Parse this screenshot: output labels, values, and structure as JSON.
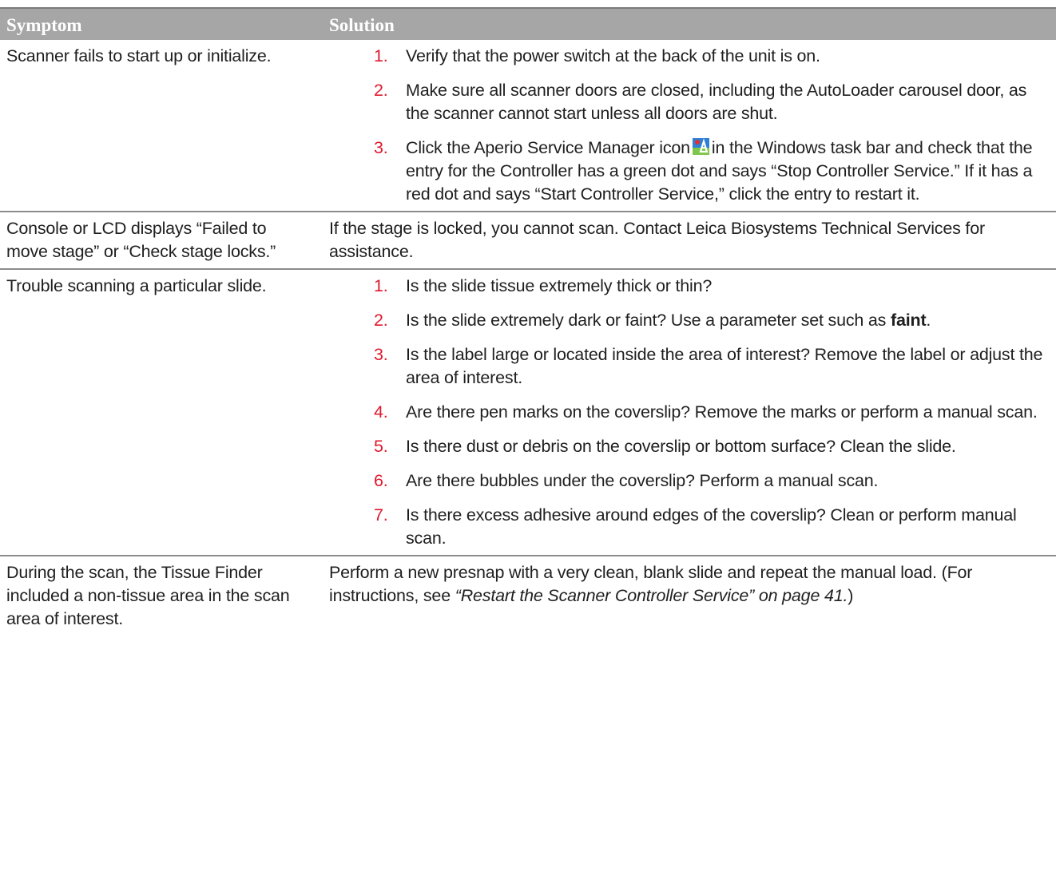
{
  "table": {
    "headers": {
      "symptom": "Symptom",
      "solution": "Solution"
    },
    "rows": [
      {
        "symptom": "Scanner fails to start up or initialize.",
        "steps": [
          {
            "num": "1.",
            "text": "Verify that the power switch at the back of the unit is on."
          },
          {
            "num": "2.",
            "text": "Make sure all scanner doors are closed, including the AutoLoader carousel door, as the scanner cannot start unless all doors are shut."
          },
          {
            "num": "3.",
            "text_a": "Click the Aperio Service Manager icon",
            "icon": "aperio-service-manager-icon",
            "text_b": "in the Windows task bar and check that the entry for the Controller has a green dot and says “Stop Controller Service.” If it has a red dot and says “Start Controller Service,” click the entry to restart it."
          }
        ]
      },
      {
        "symptom": "Console or LCD displays “Failed to move stage” or “Check stage locks.”",
        "solution": "If the stage is locked, you cannot scan. Contact Leica Biosystems Technical Services for assistance."
      },
      {
        "symptom": "Trouble scanning a particular slide.",
        "steps": [
          {
            "num": "1.",
            "text": "Is the slide tissue extremely thick or thin?"
          },
          {
            "num": "2.",
            "text_a": "Is the slide extremely dark or faint? Use a parameter set such as",
            "bold": "faint",
            "text_b": "."
          },
          {
            "num": "3.",
            "text": "Is the label large or located inside the area of interest? Remove the label or adjust the area of interest."
          },
          {
            "num": "4.",
            "text": "Are there pen marks on the coverslip? Remove the marks or perform a manual scan."
          },
          {
            "num": "5.",
            "text": "Is there dust or debris on the coverslip or bottom surface? Clean the slide."
          },
          {
            "num": "6.",
            "text": "Are there bubbles under the coverslip? Perform a manual scan."
          },
          {
            "num": "7.",
            "text": "Is there excess adhesive around edges of the coverslip? Clean or perform manual scan."
          }
        ]
      },
      {
        "symptom": "During the scan, the Tissue Finder included a non-tissue area in the scan area of interest.",
        "solution_a": "Perform a new presnap with a very clean, blank slide and repeat the manual load. (For instructions, see",
        "solution_link": "“Restart the Scanner Controller Service” on page 41.",
        "solution_b": ")"
      }
    ]
  }
}
